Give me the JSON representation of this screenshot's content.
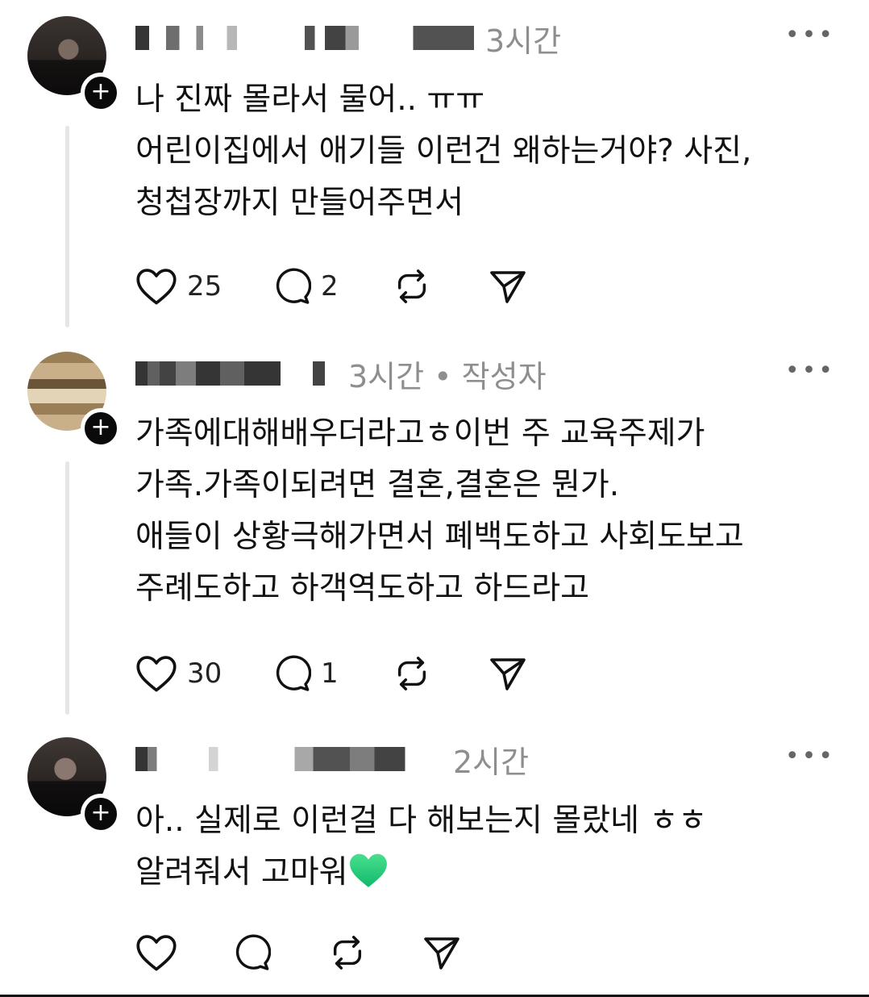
{
  "posts": [
    {
      "username": "",
      "time": "3시간",
      "lines": [
        "나 진짜 몰라서 물어.. ㅠㅠ",
        "어린이집에서 애기들 이런건 왜하는거야? 사진,",
        "청첩장까지 만들어주면서"
      ],
      "likes": "25",
      "replies": "2"
    },
    {
      "username": "",
      "time": "3시간 • 작성자",
      "lines": [
        "가족에대해배우더라고ㅎ이번 주 교육주제가",
        "가족.가족이되려면 결혼,결혼은 뭔가.",
        "애들이 상황극해가면서 폐백도하고 사회도보고",
        "주례도하고 하객역도하고 하드라고"
      ],
      "likes": "30",
      "replies": "1"
    },
    {
      "username": "",
      "time": "2시간",
      "lines": [
        "아.. 실제로 이런걸 다 해보는지 몰랐네 ㅎㅎ",
        "알려줘서 고마워"
      ],
      "likes": "",
      "replies": ""
    }
  ],
  "icons": {
    "more": "more-horizontal-icon",
    "like": "heart-icon",
    "reply": "comment-icon",
    "repost": "repost-icon",
    "share": "send-icon",
    "follow": "plus-icon",
    "emoji": "green-heart-emoji"
  },
  "colors": {
    "meta": "#8e8e8e",
    "text": "#111111",
    "emoji": "#26d07c"
  }
}
